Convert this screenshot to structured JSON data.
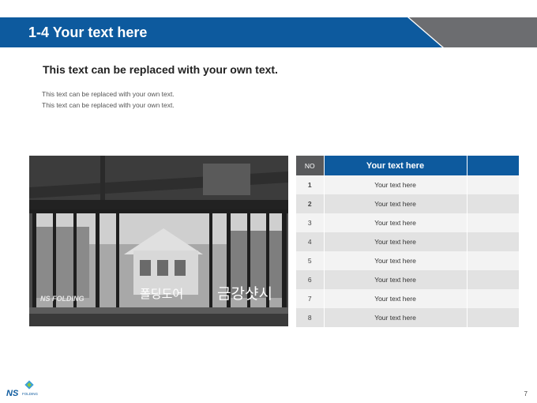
{
  "header": {
    "title": "1-4 Your text here"
  },
  "subtitle": "This text can be replaced with your own text.",
  "body_lines": [
    "This text can be replaced with your own text.",
    "This text can be replaced with your own text."
  ],
  "photo": {
    "caption_left": "폴딩도어",
    "caption_right": "금강샷시",
    "brand": "NS FOLDING"
  },
  "table": {
    "header_no": "NO",
    "header_title": "Your text here",
    "rows": [
      {
        "no": "1",
        "text": "Your text here"
      },
      {
        "no": "2",
        "text": "Your text here"
      },
      {
        "no": "3",
        "text": "Your text here"
      },
      {
        "no": "4",
        "text": "Your text here"
      },
      {
        "no": "5",
        "text": "Your text here"
      },
      {
        "no": "6",
        "text": "Your text here"
      },
      {
        "no": "7",
        "text": "Your text here"
      },
      {
        "no": "8",
        "text": "Your text here"
      }
    ]
  },
  "footer": {
    "logo_text": "NS",
    "logo_sub": "FOLDING",
    "page_number": "7"
  },
  "colors": {
    "brand_blue": "#0d5a9e",
    "brand_gray": "#6c6d70"
  }
}
